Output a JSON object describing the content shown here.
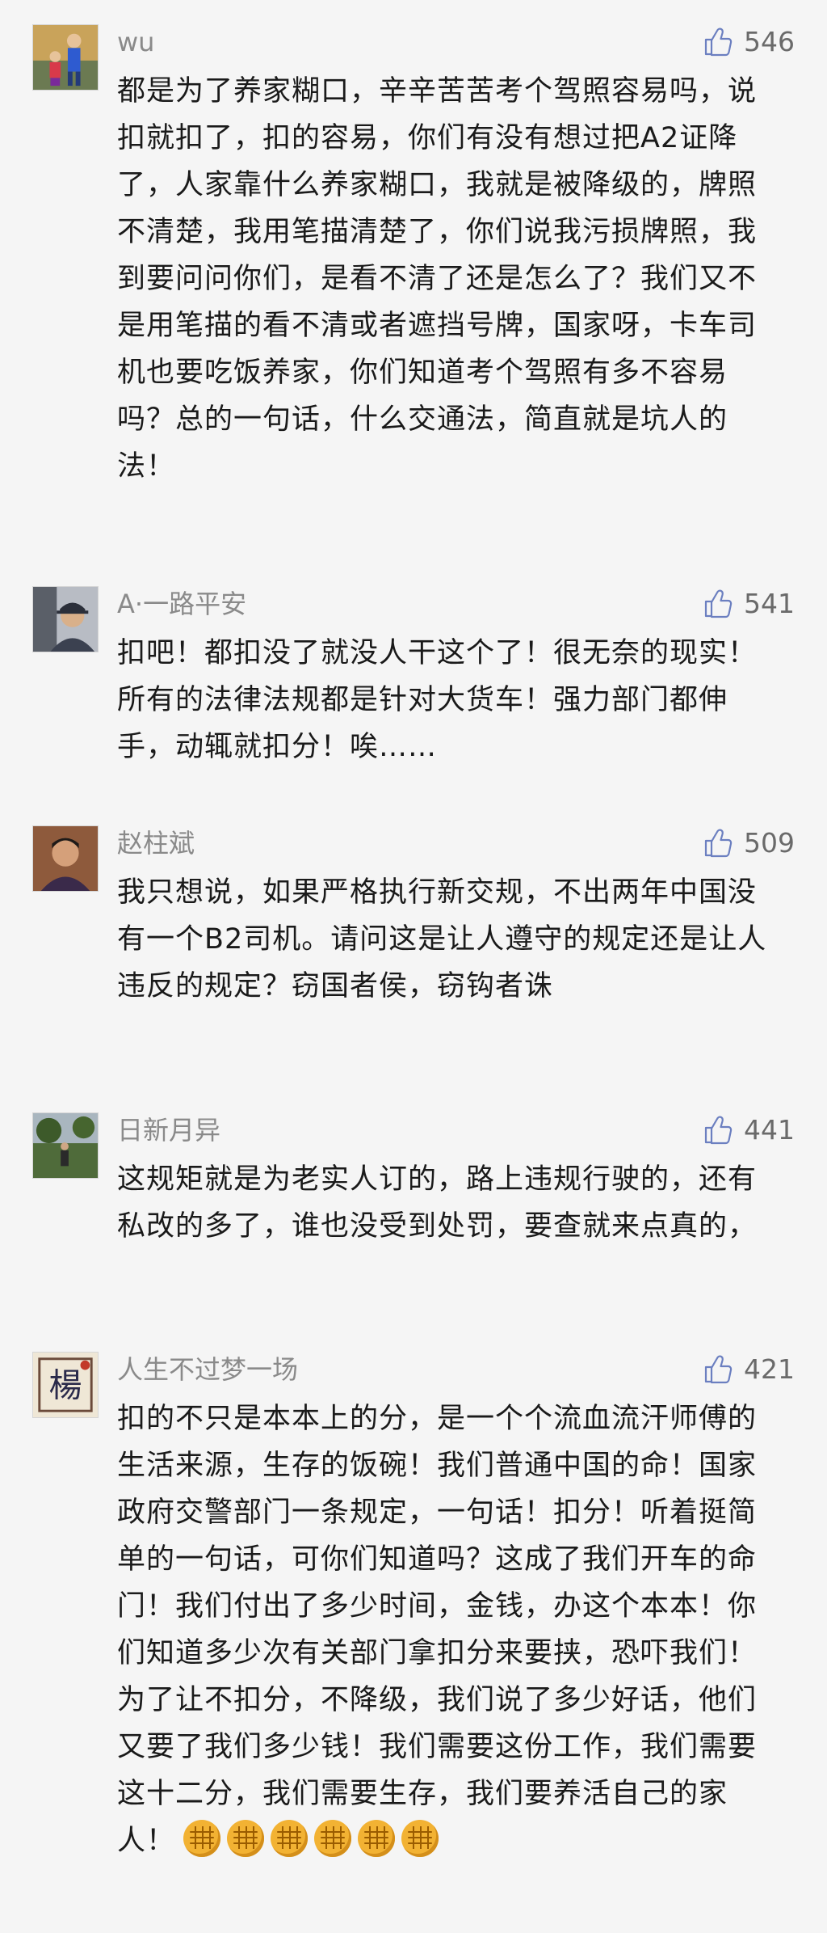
{
  "comments": [
    {
      "username": "wu",
      "likes": "546",
      "avatar_icon": "user-photo-child",
      "text": "都是为了养家糊口，辛辛苦苦考个驾照容易吗，说扣就扣了，扣的容易，你们有没有想过把A2证降了，人家靠什么养家糊口，我就是被降级的，牌照不清楚，我用笔描清楚了，你们说我污损牌照，我到要问问你们，是看不清了还是怎么了？我们又不是用笔描的看不清或者遮挡号牌，国家呀，卡车司机也要吃饭养家，你们知道考个驾照有多不容易吗？总的一句话，什么交通法，简直就是坑人的法！"
    },
    {
      "username": "A·一路平安",
      "likes": "541",
      "avatar_icon": "user-photo-man-cap",
      "text": "扣吧！都扣没了就没人干这个了！很无奈的现实！所有的法律法规都是针对大货车！强力部门都伸手，动辄就扣分！唉……"
    },
    {
      "username": "赵柱斌",
      "likes": "509",
      "avatar_icon": "user-photo-man",
      "text": "我只想说，如果严格执行新交规，不出两年中国没有一个B2司机。请问这是让人遵守的规定还是让人违反的规定？窃国者侯，窃钩者诛"
    },
    {
      "username": "日新月异",
      "likes": "441",
      "avatar_icon": "user-photo-outdoor",
      "text": "这规矩就是为老实人订的，路上违规行驶的，还有私改的多了，谁也没受到处罚，要查就来点真的，"
    },
    {
      "username": "人生不过梦一场",
      "likes": "421",
      "avatar_icon": "user-avatar-yang-seal",
      "avatar_text": "楊",
      "text": "扣的不只是本本上的分，是一个个流血流汗师傅的生活来源，生存的饭碗！我们普通中国的命！国家政府交警部门一条规定，一句话！扣分！听着挺简单的一句话，可你们知道吗？这成了我们开车的命门！我们付出了多少时间，金钱，办这个本本！你们知道多少次有关部门拿扣分来要挟，恐吓我们！为了让不扣分，不降级，我们说了多少好话，他们又要了我们多少钱！我们需要这份工作，我们需要这十二分，我们需要生存，我们要养活自己的家人！",
      "emoji": "fist-emoji",
      "emoji_count": 6
    }
  ],
  "colors": {
    "background": "#f5f5f5",
    "username": "#8a8a8a",
    "likes": "#6a6a6a",
    "text": "#1a1a1a"
  }
}
